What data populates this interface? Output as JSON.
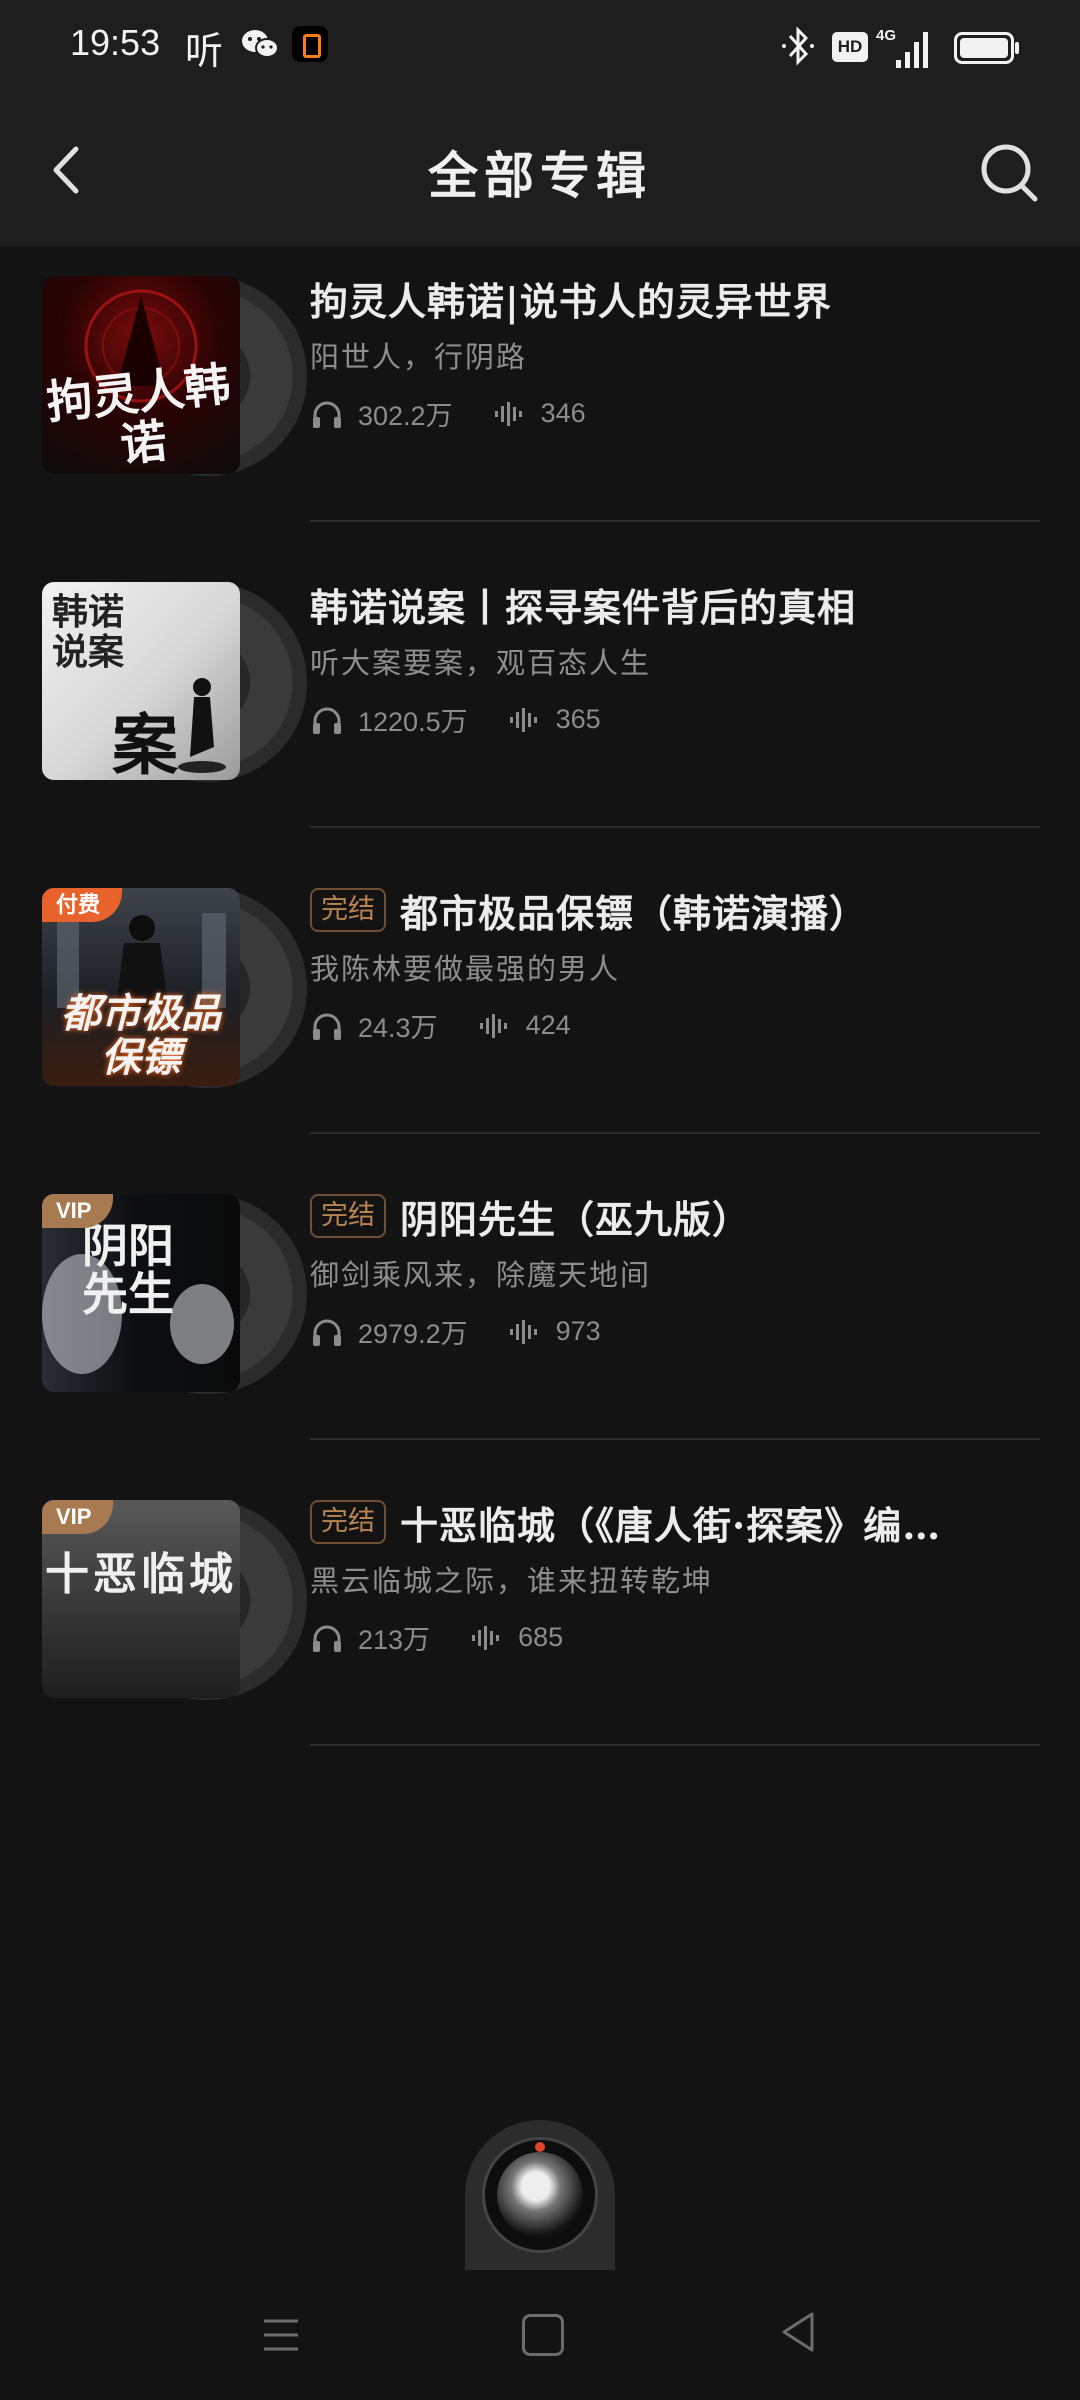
{
  "status_bar": {
    "time": "19:53",
    "ting_label": "听",
    "hd_label": "HD",
    "network": "4G",
    "icons": [
      "wechat-icon",
      "app-notification-icon",
      "bluetooth-icon",
      "signal-icon",
      "battery-icon"
    ]
  },
  "header": {
    "title": "全部专辑",
    "back_icon": "chevron-left-icon",
    "search_icon": "search-icon"
  },
  "albums": [
    {
      "title": "拘灵人韩诺|说书人的灵异世界",
      "subtitle": "阳世人，行阴路",
      "plays": "302.2万",
      "tracks": "346",
      "tag": "",
      "badge": "",
      "cover_text": "拘灵人韩诺"
    },
    {
      "title": "韩诺说案丨探寻案件背后的真相",
      "subtitle": "听大案要案，观百态人生",
      "plays": "1220.5万",
      "tracks": "365",
      "tag": "",
      "badge": "",
      "cover_text": "韩诺说案"
    },
    {
      "title": "都市极品保镖（韩诺演播）",
      "subtitle": "我陈林要做最强的男人",
      "plays": "24.3万",
      "tracks": "424",
      "tag": "完结",
      "badge": "付费",
      "cover_text": "都市极品保镖"
    },
    {
      "title": "阴阳先生（巫九版）",
      "subtitle": "御剑乘风来，除魔天地间",
      "plays": "2979.2万",
      "tracks": "973",
      "tag": "完结",
      "badge": "VIP",
      "cover_text": "阴阳先生"
    },
    {
      "title": "十恶临城（《唐人街·探案》编…",
      "subtitle": "黑云临城之际，谁来扭转乾坤",
      "plays": "213万",
      "tracks": "685",
      "tag": "完结",
      "badge": "VIP",
      "cover_text": "十恶临城"
    }
  ],
  "nav_bar": {
    "icons": [
      "menu-icon",
      "home-icon",
      "back-triangle-icon"
    ]
  },
  "colors": {
    "background": "#131313",
    "header": "#1e1e1e",
    "tag": "#b88452",
    "paid_badge": "#e8632c",
    "vip_badge": "#a87a52"
  }
}
